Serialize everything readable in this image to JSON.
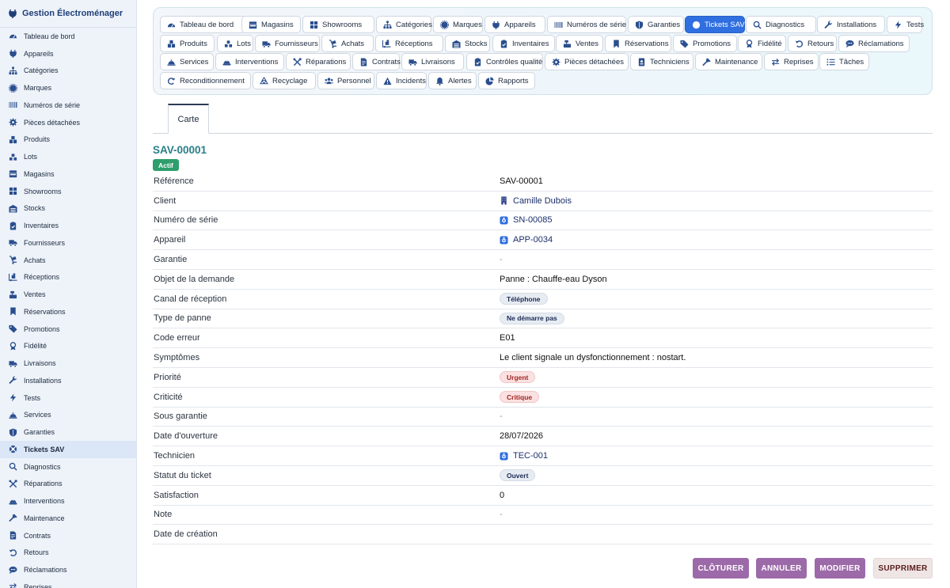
{
  "app": {
    "title": "Gestion Électroménager"
  },
  "sidebar": {
    "items": [
      {
        "label": "Tableau de bord",
        "icon": "dashboard-icon"
      },
      {
        "label": "Appareils",
        "icon": "plug-icon"
      },
      {
        "label": "Catégories",
        "icon": "sitemap-icon"
      },
      {
        "label": "Marques",
        "icon": "badge-icon"
      },
      {
        "label": "Numéros de série",
        "icon": "barcode-icon"
      },
      {
        "label": "Pièces détachées",
        "icon": "cog-icon"
      },
      {
        "label": "Produits",
        "icon": "boxes-icon"
      },
      {
        "label": "Lots",
        "icon": "cubes-icon"
      },
      {
        "label": "Magasins",
        "icon": "store-icon"
      },
      {
        "label": "Showrooms",
        "icon": "grid-icon"
      },
      {
        "label": "Stocks",
        "icon": "warehouse-icon"
      },
      {
        "label": "Inventaires",
        "icon": "clipboard-check-icon"
      },
      {
        "label": "Fournisseurs",
        "icon": "truck-icon"
      },
      {
        "label": "Achats",
        "icon": "dolly-icon"
      },
      {
        "label": "Réceptions",
        "icon": "truck-loading-icon"
      },
      {
        "label": "Ventes",
        "icon": "cash-register-icon"
      },
      {
        "label": "Réservations",
        "icon": "bookmark-icon"
      },
      {
        "label": "Promotions",
        "icon": "tags-icon"
      },
      {
        "label": "Fidélité",
        "icon": "award-icon"
      },
      {
        "label": "Livraisons",
        "icon": "shipping-icon"
      },
      {
        "label": "Installations",
        "icon": "wrench-icon"
      },
      {
        "label": "Tests",
        "icon": "bolt-icon"
      },
      {
        "label": "Services",
        "icon": "bell-concierge-icon"
      },
      {
        "label": "Garanties",
        "icon": "shield-icon"
      },
      {
        "label": "Tickets SAV",
        "icon": "life-ring-icon",
        "active": true
      },
      {
        "label": "Diagnostics",
        "icon": "search-icon"
      },
      {
        "label": "Réparations",
        "icon": "tools-icon"
      },
      {
        "label": "Interventions",
        "icon": "hard-hat-icon"
      },
      {
        "label": "Maintenance",
        "icon": "hammer-icon"
      },
      {
        "label": "Contrats",
        "icon": "file-contract-icon"
      },
      {
        "label": "Retours",
        "icon": "undo-icon"
      },
      {
        "label": "Réclamations",
        "icon": "comment-icon"
      },
      {
        "label": "Reprises",
        "icon": "exchange-icon"
      }
    ]
  },
  "modules": {
    "rows": [
      [
        {
          "label": "Tableau de bord",
          "icon": "dashboard-icon"
        },
        {
          "label": "Magasins",
          "icon": "store-icon"
        },
        {
          "label": "Showrooms",
          "icon": "grid-icon"
        },
        {
          "label": "Catégories",
          "icon": "sitemap-icon"
        },
        {
          "label": "Marques",
          "icon": "badge-icon"
        },
        {
          "label": "Appareils",
          "icon": "plug-icon"
        },
        {
          "label": "Numéros de série",
          "icon": "barcode-icon"
        },
        {
          "label": "Garanties",
          "icon": "shield-icon"
        },
        {
          "label": "Tickets SAV",
          "icon": "life-ring-icon",
          "active": true
        },
        {
          "label": "Diagnostics",
          "icon": "search-icon"
        },
        {
          "label": "Installations",
          "icon": "wrench-icon"
        },
        {
          "label": "Tests",
          "icon": "bolt-icon"
        }
      ],
      [
        {
          "label": "Produits",
          "icon": "boxes-icon"
        },
        {
          "label": "Lots",
          "icon": "cubes-icon"
        },
        {
          "label": "Fournisseurs",
          "icon": "truck-icon"
        },
        {
          "label": "Achats",
          "icon": "dolly-icon"
        },
        {
          "label": "Réceptions",
          "icon": "truck-loading-icon"
        },
        {
          "label": "Stocks",
          "icon": "warehouse-icon"
        },
        {
          "label": "Inventaires",
          "icon": "clipboard-check-icon"
        },
        {
          "label": "Ventes",
          "icon": "cash-register-icon"
        },
        {
          "label": "Réservations",
          "icon": "bookmark-icon"
        },
        {
          "label": "Promotions",
          "icon": "tags-icon"
        },
        {
          "label": "Fidélité",
          "icon": "award-icon"
        },
        {
          "label": "Retours",
          "icon": "undo-icon"
        },
        {
          "label": "Réclamations",
          "icon": "comment-icon"
        }
      ],
      [
        {
          "label": "Services",
          "icon": "bell-concierge-icon"
        },
        {
          "label": "Interventions",
          "icon": "hard-hat-icon"
        },
        {
          "label": "Réparations",
          "icon": "tools-icon"
        },
        {
          "label": "Contrats",
          "icon": "file-contract-icon"
        },
        {
          "label": "Livraisons",
          "icon": "shipping-icon"
        },
        {
          "label": "Contrôles qualité",
          "icon": "clipboard-check-icon"
        },
        {
          "label": "Pièces détachées",
          "icon": "cog-icon"
        },
        {
          "label": "Techniciens",
          "icon": "id-badge-icon"
        },
        {
          "label": "Maintenance",
          "icon": "hammer-icon"
        },
        {
          "label": "Reprises",
          "icon": "exchange-icon"
        },
        {
          "label": "Tâches",
          "icon": "list-icon"
        }
      ],
      [
        {
          "label": "Reconditionnement",
          "icon": "redo-icon"
        },
        {
          "label": "Recyclage",
          "icon": "recycle-icon"
        },
        {
          "label": "Personnel",
          "icon": "users-icon"
        },
        {
          "label": "Incidents",
          "icon": "warning-icon"
        },
        {
          "label": "Alertes",
          "icon": "bell-icon"
        },
        {
          "label": "Rapports",
          "icon": "pie-chart-icon"
        }
      ]
    ]
  },
  "tabs": [
    {
      "label": "Carte"
    }
  ],
  "record": {
    "title": "SAV-00001",
    "status": "Actif",
    "fields": [
      {
        "label": "Référence",
        "value": "SAV-00001",
        "type": "text"
      },
      {
        "label": "Client",
        "value": "Camille Dubois",
        "type": "link",
        "icon": "building-icon"
      },
      {
        "label": "Numéro de série",
        "value": "SN-00085",
        "type": "link",
        "icon": "object-icon"
      },
      {
        "label": "Appareil",
        "value": "APP-0034",
        "type": "link",
        "icon": "object-icon"
      },
      {
        "label": "Garantie",
        "value": "-",
        "type": "empty"
      },
      {
        "label": "Objet de la demande",
        "value": "Panne : Chauffe-eau Dyson",
        "type": "text"
      },
      {
        "label": "Canal de réception",
        "value": "Téléphone",
        "type": "badge-gray"
      },
      {
        "label": "Type de panne",
        "value": "Ne démarre pas",
        "type": "badge-gray"
      },
      {
        "label": "Code erreur",
        "value": "E01",
        "type": "text"
      },
      {
        "label": "Symptômes",
        "value": "Le client signale un dysfonctionnement : nostart.",
        "type": "text"
      },
      {
        "label": "Priorité",
        "value": "Urgent",
        "type": "badge-red"
      },
      {
        "label": "Criticité",
        "value": "Critique",
        "type": "badge-red"
      },
      {
        "label": "Sous garantie",
        "value": "-",
        "type": "empty"
      },
      {
        "label": "Date d'ouverture",
        "value": "28/07/2026",
        "type": "text"
      },
      {
        "label": "Technicien",
        "value": "TEC-001",
        "type": "link",
        "icon": "object-icon"
      },
      {
        "label": "Statut du ticket",
        "value": "Ouvert",
        "type": "badge-gray"
      },
      {
        "label": "Satisfaction",
        "value": "0",
        "type": "text"
      },
      {
        "label": "Note",
        "value": "-",
        "type": "empty"
      },
      {
        "label": "Date de création",
        "value": "",
        "type": "text"
      }
    ]
  },
  "actions": {
    "close_label": "CLÔTURER",
    "cancel_label": "ANNULER",
    "edit_label": "MODIFIER",
    "delete_label": "SUPPRIMER"
  },
  "colors": {
    "accent": "#2f6fe0",
    "title": "#2a7f87",
    "status_active": "#2e9e6c",
    "action_purple": "#9c6aa8"
  }
}
